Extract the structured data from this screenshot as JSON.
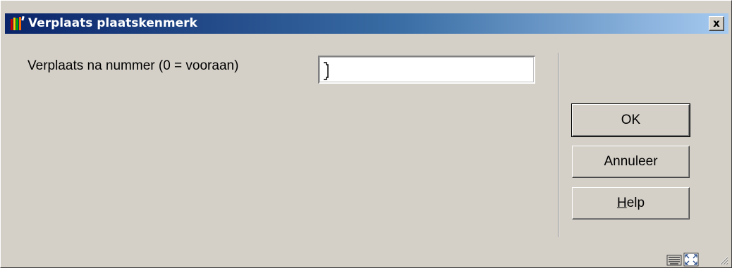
{
  "window": {
    "title": "Verplaats plaatskenmerk",
    "close_label": "x"
  },
  "form": {
    "label": "Verplaats na nummer (0 = vooraan)",
    "value": ""
  },
  "buttons": {
    "ok": "OK",
    "cancel": "Annuleer",
    "help_mnemonic": "H",
    "help_rest": "elp"
  },
  "icons": {
    "app": "books-icon",
    "keyboard": "keyboard-icon",
    "fullscreen": "fullscreen-icon",
    "grip": "resize-grip-icon"
  },
  "colors": {
    "titlebar_start": "#0a246a",
    "titlebar_end": "#a6caf0",
    "face": "#d4d0c8"
  }
}
